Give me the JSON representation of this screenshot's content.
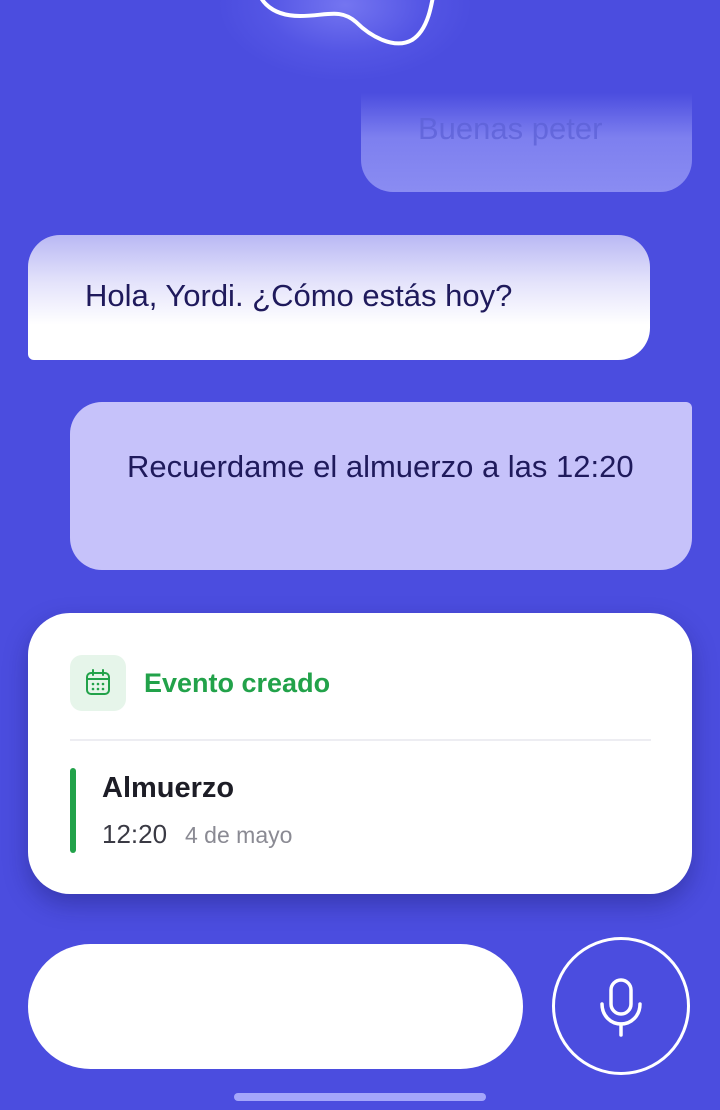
{
  "chat": {
    "faded_message": "Buenas peter",
    "assistant_message": "Hola, Yordi. ¿Cómo estás hoy?",
    "user_message": "Recuerdame el almuerzo a las 12:20"
  },
  "event_card": {
    "icon": "calendar-icon",
    "status": "Evento creado",
    "title": "Almuerzo",
    "time": "12:20",
    "date": "4 de mayo"
  },
  "composer": {
    "input_value": "",
    "mic_icon": "microphone-icon"
  },
  "colors": {
    "background": "#4b4ddf",
    "user_bubble": "#c6c2fa",
    "assistant_bubble": "#ffffff",
    "event_accent": "#22a24a",
    "text_dark": "#1f1a5c"
  }
}
